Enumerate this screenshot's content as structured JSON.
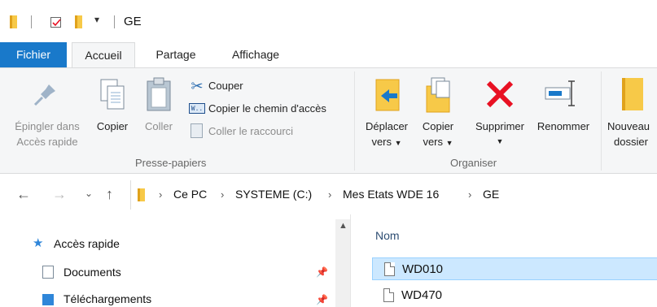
{
  "window": {
    "title": "GE"
  },
  "ribbon_tabs": [
    "Fichier",
    "Accueil",
    "Partage",
    "Affichage"
  ],
  "clipboard": {
    "pin_label_1": "Épingler dans",
    "pin_label_2": "Accès rapide",
    "copy": "Copier",
    "paste": "Coller",
    "cut": "Couper",
    "copy_path": "Copier le chemin d'accès",
    "paste_shortcut": "Coller le raccourci",
    "group": "Presse-papiers"
  },
  "organize": {
    "move_1": "Déplacer",
    "move_2": "vers",
    "copy_1": "Copier",
    "copy_2": "vers",
    "delete": "Supprimer",
    "rename": "Renommer",
    "group": "Organiser"
  },
  "new": {
    "new_1": "Nouveau",
    "new_2": "dossier"
  },
  "address": {
    "crumbs": [
      "Ce PC",
      "SYSTEME (C:)",
      "Mes Etats WDE 16",
      "GE"
    ]
  },
  "nav": {
    "quick_access": "Accès rapide",
    "documents": "Documents",
    "downloads": "Téléchargements"
  },
  "content": {
    "column_name": "Nom",
    "files": [
      {
        "name": "WD010",
        "selected": true
      },
      {
        "name": "WD470",
        "selected": false
      }
    ]
  },
  "colors": {
    "file_tab": "#1979ca",
    "selection": "#cce8ff",
    "folder": "#f7c948",
    "delete_x": "#e81123"
  }
}
